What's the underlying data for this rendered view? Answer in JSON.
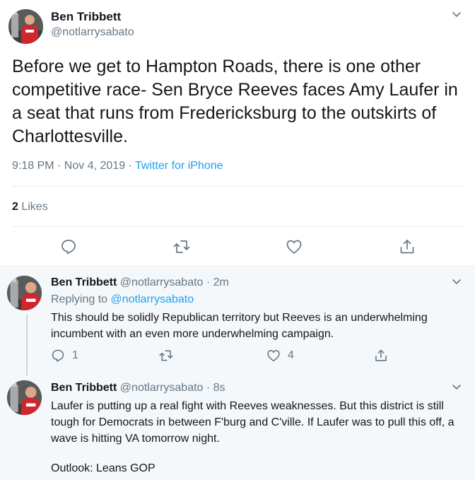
{
  "main_tweet": {
    "name": "Ben Tribbett",
    "handle": "@notlarrysabato",
    "text": "Before we get to Hampton Roads, there is one other competitive race- Sen Bryce Reeves faces Amy Laufer in a seat that runs from Fredericksburg to the outskirts of Charlottesville.",
    "time": "9:18 PM · Nov 4, 2019 · ",
    "source": "Twitter for iPhone",
    "likes_count": "2",
    "likes_label": " Likes"
  },
  "replies": [
    {
      "name": "Ben Tribbett",
      "handle_time": "@notlarrysabato · 2m",
      "replying_prefix": "Replying to ",
      "replying_handle": "@notlarrysabato",
      "text": "This should be solidly Republican territory but Reeves is an underwhelming incumbent with an even more underwhelming campaign.",
      "reply_count": "1",
      "retweet_count": "",
      "like_count": "4"
    },
    {
      "name": "Ben Tribbett",
      "handle_time": "@notlarrysabato · 8s",
      "text": "Laufer is putting up a real fight with Reeves weaknesses.  But this district is still tough for Democrats in between F'burg and C'ville.  If Laufer was to pull this off, a wave is hitting VA tomorrow night.",
      "text2": "Outlook:  Leans GOP"
    }
  ],
  "icons": [
    "chevron-down-icon",
    "reply-icon",
    "retweet-icon",
    "like-icon",
    "share-icon"
  ],
  "colors": {
    "accent": "#1da1f2",
    "secondary_text": "#657786",
    "primary_text": "#14171a"
  }
}
